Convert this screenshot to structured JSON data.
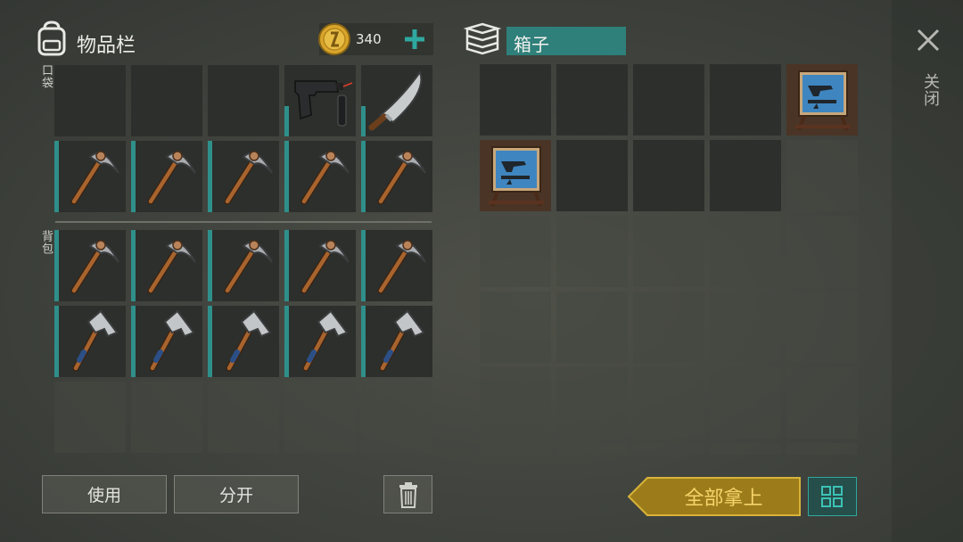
{
  "inventory": {
    "title": "物品栏",
    "coins": "340",
    "pocket_label": "口袋",
    "backpack_label": "背包",
    "pocket_items": [
      "empty",
      "empty",
      "empty",
      "pistol",
      "machete",
      "pickaxe",
      "pickaxe",
      "pickaxe",
      "pickaxe",
      "pickaxe"
    ],
    "backpack_items": [
      "pickaxe",
      "pickaxe",
      "pickaxe",
      "pickaxe",
      "pickaxe",
      "hammer",
      "hammer",
      "hammer",
      "hammer",
      "hammer",
      "empty",
      "empty",
      "empty",
      "empty",
      "empty"
    ]
  },
  "box": {
    "title": "箱子",
    "items": [
      "empty",
      "empty",
      "empty",
      "empty",
      "weapon-rack",
      "weapon-rack",
      "empty",
      "empty",
      "empty",
      "empty",
      "empty",
      "empty",
      "empty",
      "empty",
      "empty",
      "empty",
      "empty",
      "empty",
      "empty",
      "empty",
      "empty",
      "empty",
      "empty",
      "empty",
      "empty",
      "empty",
      "empty",
      "empty",
      "empty",
      "empty"
    ]
  },
  "buttons": {
    "use": "使用",
    "split": "分开",
    "take_all": "全部拿上",
    "close": "关闭"
  },
  "colors": {
    "accent_teal": "#2f8f8a",
    "gold": "#c9a32a",
    "title_field": "#2f7f7a"
  }
}
